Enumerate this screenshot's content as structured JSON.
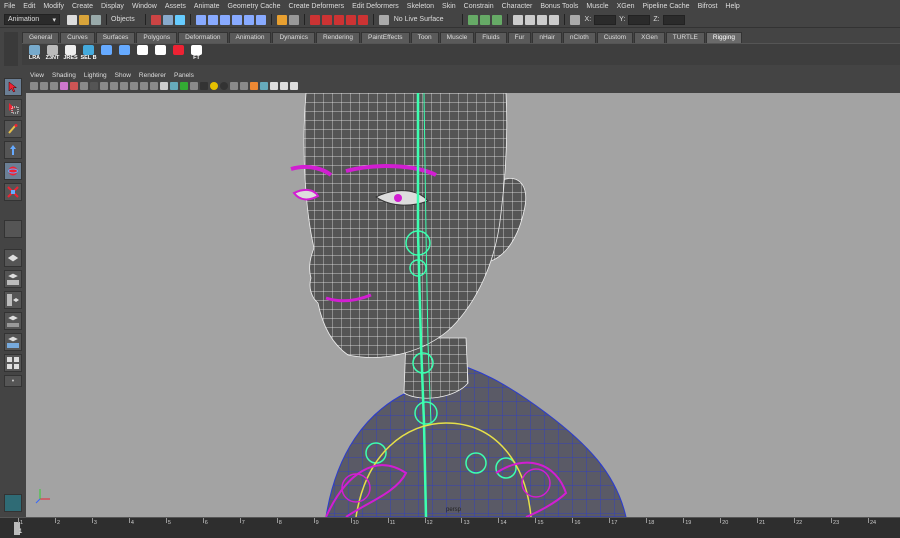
{
  "menu": [
    "File",
    "Edit",
    "Modify",
    "Create",
    "Display",
    "Window",
    "Assets",
    "Animate",
    "Geometry Cache",
    "Create Deformers",
    "Edit Deformers",
    "Skeleton",
    "Skin",
    "Constrain",
    "Character",
    "Bonus Tools",
    "Muscle",
    "XGen",
    "Pipeline Cache",
    "Bifrost",
    "Help"
  ],
  "status": {
    "mode": "Animation",
    "selection_label": "Objects",
    "live_surface": "No Live Surface",
    "x_label": "X:",
    "y_label": "Y:",
    "z_label": "Z:"
  },
  "shelf_tabs": [
    "General",
    "Curves",
    "Surfaces",
    "Polygons",
    "Deformation",
    "Animation",
    "Dynamics",
    "Rendering",
    "PaintEffects",
    "Toon",
    "Muscle",
    "Fluids",
    "Fur",
    "nHair",
    "nCloth",
    "Custom",
    "XGen",
    "TURTLE",
    "Rigging"
  ],
  "active_shelf_tab": "Rigging",
  "shelf_buttons": [
    {
      "label": "LRA",
      "icon": "lra-icon"
    },
    {
      "label": "Z3NT",
      "icon": "joint-orient-icon"
    },
    {
      "label": "JRES",
      "icon": "joint-reset-icon"
    },
    {
      "label": "SEL B",
      "icon": "select-bones-icon"
    },
    {
      "label": "",
      "icon": "joint-chain-icon"
    },
    {
      "label": "",
      "icon": "joint-tool-icon"
    },
    {
      "label": "",
      "icon": "ik-handle-icon"
    },
    {
      "label": "",
      "icon": "ik-spline-icon"
    },
    {
      "label": "",
      "icon": "bind-skin-icon"
    },
    {
      "label": "FT",
      "icon": "fk-toggle-icon"
    }
  ],
  "panel_menu": [
    "View",
    "Shading",
    "Lighting",
    "Show",
    "Renderer",
    "Panels"
  ],
  "viewport": {
    "camera_label": "persp"
  },
  "timeline": {
    "start": 1,
    "end": 24,
    "ticks": [
      "1",
      "2",
      "3",
      "4",
      "5",
      "6",
      "7",
      "8",
      "9",
      "10",
      "11",
      "12",
      "13",
      "14",
      "15",
      "16",
      "17",
      "18",
      "19",
      "20",
      "21",
      "22",
      "23",
      "24"
    ],
    "current_frame": "1"
  },
  "colors": {
    "viewport_bg": "#a3a3a3",
    "wireframe": "#ffffff",
    "joints": "#3dffb0",
    "controls_magenta": "#d21ed2",
    "selection_yellow": "#e6e04a",
    "mesh_blue": "#1f2fb5"
  }
}
